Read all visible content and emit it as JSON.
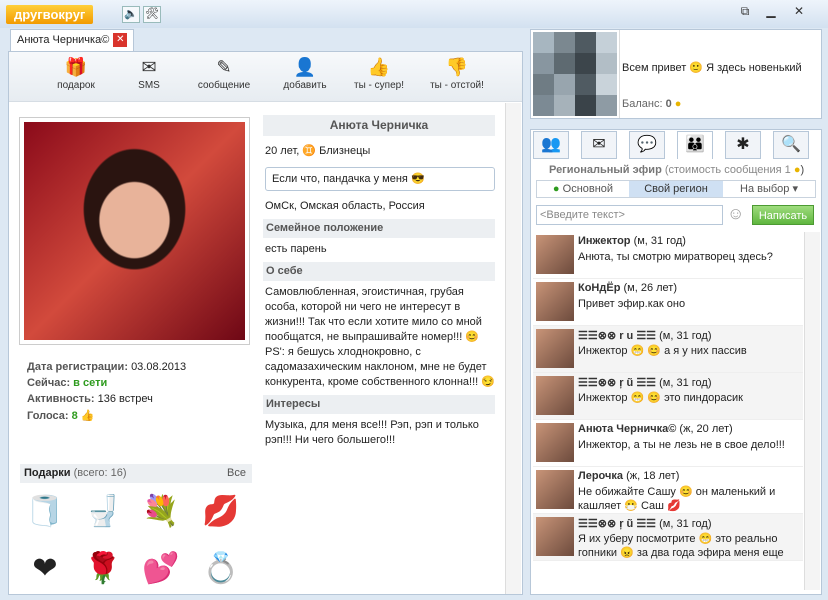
{
  "titlebar": {
    "logo": "другвокруг",
    "ico1": "🔈",
    "ico2": "🛠",
    "btn_restore": "⧉",
    "btn_min": "▁",
    "btn_close": "✕"
  },
  "tab": {
    "label": "Анюта Черничка©",
    "close": "✕"
  },
  "toolbar": [
    {
      "label": "подарок",
      "icon": "🎁"
    },
    {
      "label": "SMS",
      "icon": "✉"
    },
    {
      "label": "сообщение",
      "icon": "✎"
    },
    {
      "label": "добавить",
      "icon": "👤"
    },
    {
      "label": "ты - супер!",
      "icon": "👍"
    },
    {
      "label": "ты - отстой!",
      "icon": "👎"
    }
  ],
  "stats": {
    "reg_label": "Дата регистрации:",
    "reg_value": "03.08.2013",
    "now_label": "Сейчас:",
    "now_value": "в сети",
    "act_label": "Активность:",
    "act_value": "136 встреч",
    "votes_label": "Голоса:",
    "votes_value": "8"
  },
  "gifts": {
    "label": "Подарки",
    "count": "(всего: 16)",
    "all": "Все",
    "items": [
      "🧻",
      "🚽",
      "💐",
      "💋",
      "❤",
      "🌹",
      "💕",
      "💍"
    ]
  },
  "profile": {
    "name": "Анюта Черничка",
    "age": "20 лет,",
    "zodiac": "Близнецы",
    "status": "Если что, пандачка у меня",
    "location": "ОмСк, Омская область, Россия",
    "family_h": "Семейное положение",
    "family": "есть парень",
    "about_h": "О себе",
    "about": "Самовлюбленная, эгоистичная, грубая особа, которой ни чего не интересут в жизни!!! Так что если хотите мило со мной пообщатся, не выпрашивайте номер!!! 😊 PS': я бешусь хлоднокровно, с садомазахическим наклоном, мне не будет конкурента, кроме собственного клонна!!! 😏",
    "interests_h": "Интересы",
    "interests": "Музыка, для меня все!!! Рэп, рэп и только рэп!!! Ни чего большего!!!"
  },
  "user": {
    "greeting": "Всем привет 🙂 Я здесь новенький",
    "balance_label": "Баланс:",
    "balance": "0",
    "pix": [
      "#a7b6c0",
      "#7b8890",
      "#4f5a61",
      "#c5d0d8",
      "#8896a0",
      "#5e6a71",
      "#3c454b",
      "#b2bec6",
      "#6f7c84",
      "#98a5ae",
      "#505b62",
      "#c9d3da",
      "#7c8a94",
      "#a6b2ba",
      "#3a4349",
      "#8e9ba4"
    ]
  },
  "rtabs": [
    "👥",
    "✉",
    "💬",
    "👪",
    "✱",
    "🔍"
  ],
  "ether": {
    "title": "Региональный эфир",
    "cost": "(стоимость сообщения 1",
    "f1": "Основной",
    "f2": "Свой регион",
    "f3": "На выбор",
    "placeholder": "<Введите текст>",
    "send": "Написать"
  },
  "messages": [
    {
      "name": "Инжектор",
      "meta": "(м, 31 год)",
      "text": "Анюта, ты смотрю миратворец здесь?",
      "white": true
    },
    {
      "name": "КоНдЁр",
      "meta": "(м, 26 лет)",
      "text": "Привет эфир.как оно",
      "white": true
    },
    {
      "name": "☰☰⊗⊗ r u ☰☰",
      "meta": "(м, 31 год)",
      "text": "Инжектор 😁 😊 а я у них пассив",
      "white": false
    },
    {
      "name": "☰☰⊗⊗ ŗ ũ ☰☰",
      "meta": "(м, 31 год)",
      "text": "Инжектор 😁 😊 это пиндорасик",
      "white": false
    },
    {
      "name": "Анюта Черничка©",
      "meta": "(ж, 20 лет)",
      "text": "Инжектор, а ты не лезь не в свое дело!!!",
      "white": true
    },
    {
      "name": "Лерочка",
      "meta": "(ж, 18 лет)",
      "text": "Не обижайте Сашу 😊 он маленький и кашляет 😷 Саш 💋",
      "white": true
    },
    {
      "name": "☰☰⊗⊗ ŗ ũ ☰☰",
      "meta": "(м, 31 год)",
      "text": "Я их уберу посмотрите 😁 это реально гопники 😠 за два года эфира меня еще",
      "white": false
    }
  ]
}
